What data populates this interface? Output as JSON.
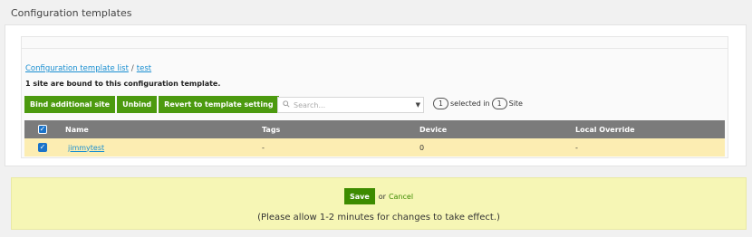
{
  "page": {
    "title": "Configuration templates"
  },
  "breadcrumb": {
    "list_link": "Configuration template list",
    "separator": "/",
    "current": "test"
  },
  "bound_text": "1 site are bound to this configuration template.",
  "toolbar": {
    "bind_label": "Bind additional site",
    "unbind_label": "Unbind",
    "revert_label": "Revert to template setting",
    "search_placeholder": "Search...",
    "selected_count": "1",
    "selected_in_text": "selected in",
    "total_count": "1",
    "site_text": "Site"
  },
  "table": {
    "columns": [
      "Name",
      "Tags",
      "Device",
      "Local Override"
    ],
    "rows": [
      {
        "name": "jimmytest",
        "tags": "-",
        "device": "0",
        "local_override": "-",
        "checked": true
      }
    ]
  },
  "footer": {
    "save_label": "Save",
    "or_text": "or",
    "cancel_label": "Cancel",
    "note": "(Please allow 1-2 minutes for changes to take effect.)"
  },
  "colors": {
    "accent_green": "#4c9a0f",
    "link_blue": "#1a8fd1",
    "selected_row": "#fcedb2",
    "save_panel": "#f6f6b5"
  },
  "icons": {
    "search": "search-icon",
    "dropdown": "chevron-down-icon",
    "checkbox": "checkbox-checked-icon"
  }
}
